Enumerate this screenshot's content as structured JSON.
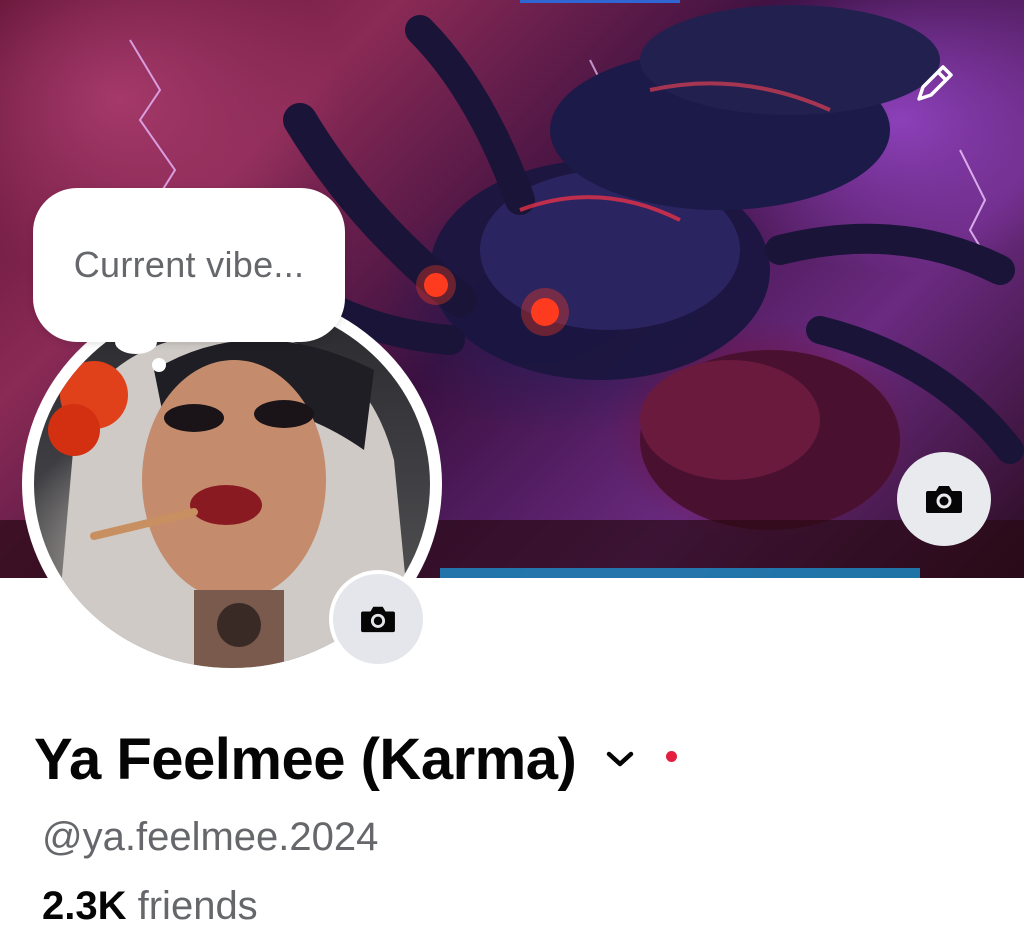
{
  "cover": {
    "edit_icon": "pencil-icon",
    "camera_icon": "camera-icon",
    "accent_strip_color": "#2f66d4"
  },
  "status_bubble": {
    "placeholder": "Current vibe..."
  },
  "avatar": {
    "camera_icon": "camera-icon"
  },
  "profile": {
    "name": "Ya Feelmee (Karma)",
    "dropdown_icon": "chevron-down-icon",
    "status_dot_color": "#e41e3f",
    "username": "@ya.feelmee.2024",
    "friends_count": "2.3K",
    "friends_label": "friends"
  }
}
